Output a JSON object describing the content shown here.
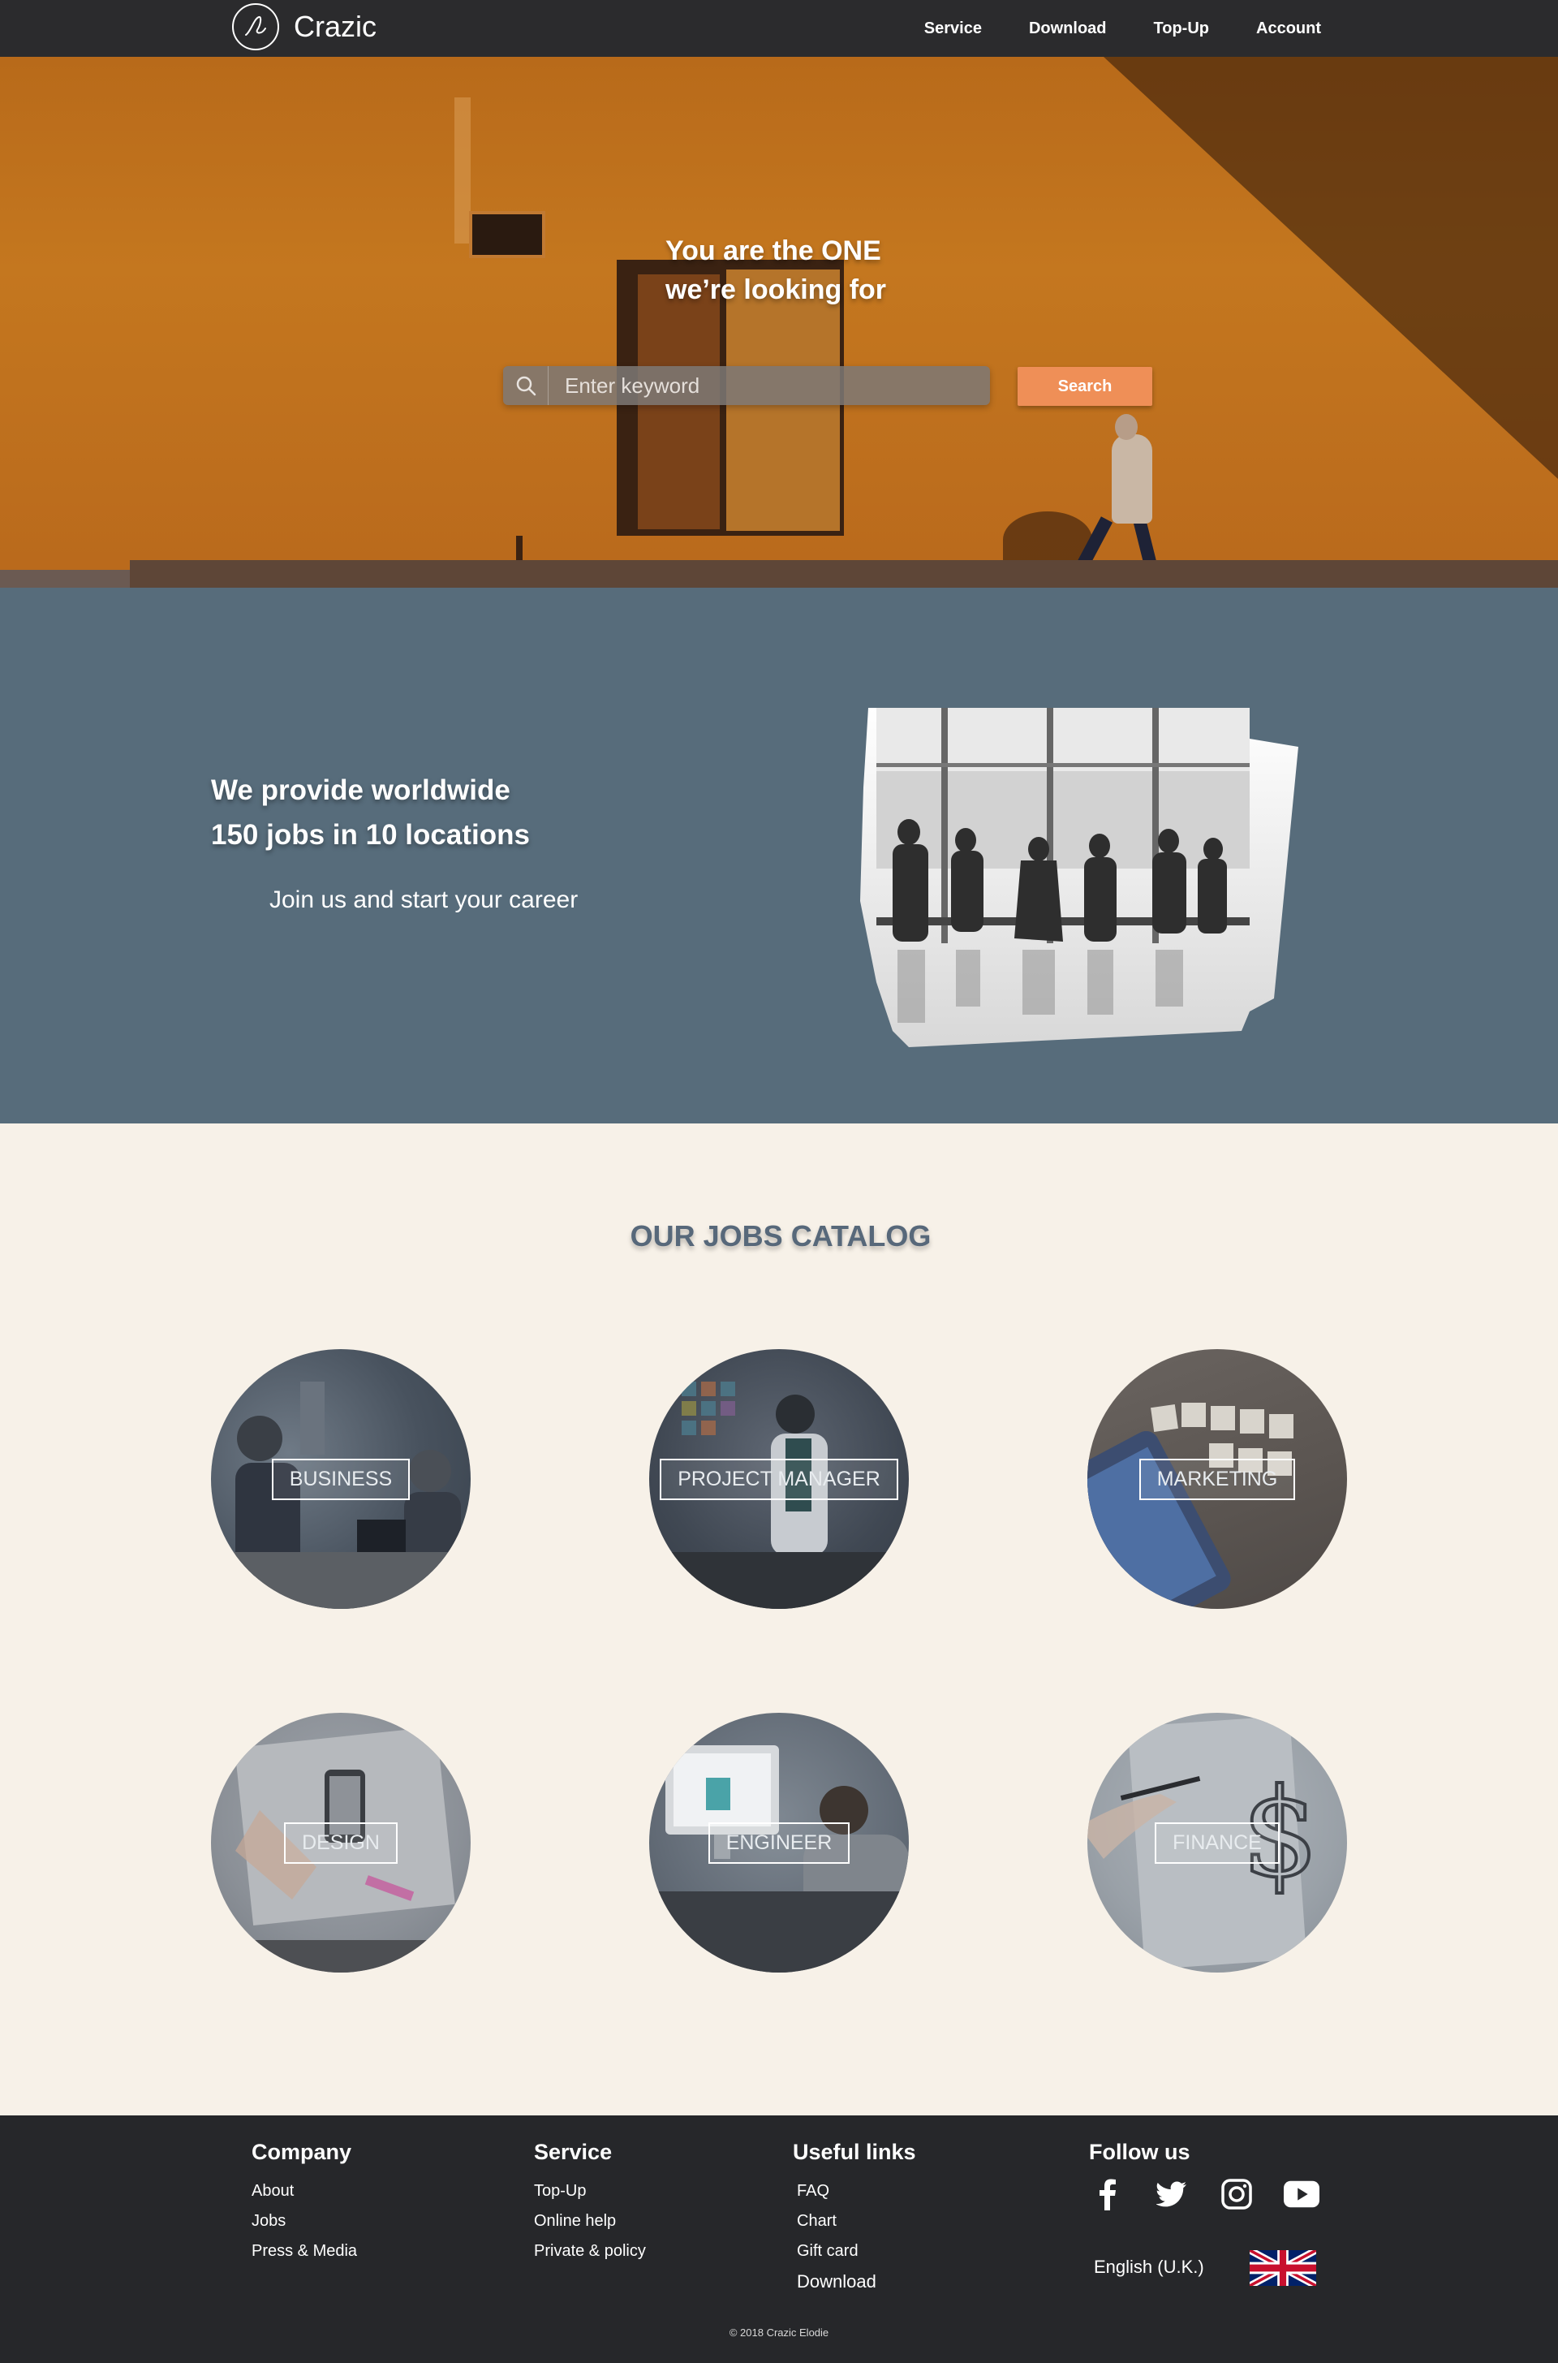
{
  "nav": {
    "brand": "Crazic",
    "links": [
      "Service",
      "Download",
      "Top-Up",
      "Account"
    ]
  },
  "hero": {
    "title_line1": "You are the ONE",
    "title_line2": "we’re looking for",
    "search_placeholder": "Enter keyword",
    "search_button": "Search"
  },
  "about": {
    "title_line1": "We provide worldwide",
    "title_line2": "150 jobs in 10 locations",
    "subtitle": "Join us and start your career"
  },
  "catalog": {
    "title": "OUR JOBS CATALOG",
    "jobs": [
      "BUSINESS",
      "PROJECT MANAGER",
      "MARKETING",
      "DESIGN",
      "ENGINEER",
      "FINANCE"
    ]
  },
  "footer": {
    "company": {
      "heading": "Company",
      "links": [
        "About",
        "Jobs",
        "Press & Media"
      ]
    },
    "service": {
      "heading": "Service",
      "links": [
        "Top-Up",
        "Online help",
        "Private & policy"
      ]
    },
    "useful": {
      "heading": "Useful links",
      "links": [
        "FAQ",
        "Chart",
        "Gift card",
        "Download"
      ]
    },
    "follow": {
      "heading": "Follow us",
      "icons": [
        "facebook-icon",
        "twitter-icon",
        "instagram-icon",
        "youtube-icon"
      ]
    },
    "language": "English (U.K.)",
    "copyright": "© 2018 Crazic Elodie"
  },
  "colors": {
    "nav_bg": "#2b2b2d",
    "accent": "#ef8f57",
    "about_bg": "#576c7b",
    "catalog_bg": "#f7f1e8",
    "catalog_title": "#57687a",
    "footer_bg": "#26272a"
  }
}
